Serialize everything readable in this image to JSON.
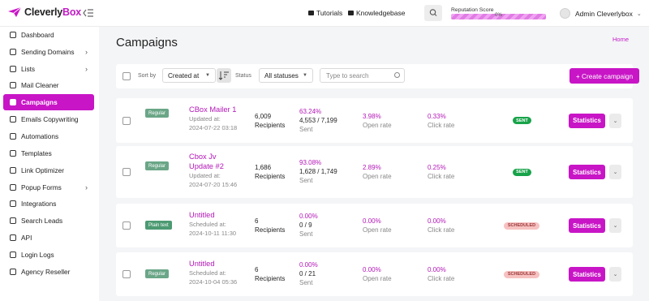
{
  "brand": {
    "name_part1": "Cleverly",
    "name_part2": "Box",
    "accent": "#c815c6"
  },
  "topbar": {
    "tutorials": "Tutorials",
    "knowledgebase": "Knowledgebase",
    "reputation_label": "Reputation Score",
    "reputation_value": "0%",
    "user_name": "Admin Cleverlybox"
  },
  "sidebar": {
    "items": [
      {
        "label": "Dashboard",
        "icon": "dashboard-icon"
      },
      {
        "label": "Sending Domains",
        "icon": "globe-icon",
        "has_sub": true
      },
      {
        "label": "Lists",
        "icon": "list-icon",
        "has_sub": true
      },
      {
        "label": "Mail Cleaner",
        "icon": "mail-icon"
      },
      {
        "label": "Campaigns",
        "icon": "send-icon",
        "active": true
      },
      {
        "label": "Emails Copywriting",
        "icon": "pen-icon"
      },
      {
        "label": "Automations",
        "icon": "gear-icon"
      },
      {
        "label": "Templates",
        "icon": "template-icon"
      },
      {
        "label": "Link Optimizer",
        "icon": "link-icon"
      },
      {
        "label": "Popup Forms",
        "icon": "popup-icon",
        "has_sub": true
      },
      {
        "label": "Integrations",
        "icon": "plug-icon"
      },
      {
        "label": "Search Leads",
        "icon": "search-icon"
      },
      {
        "label": "API",
        "icon": "api-icon"
      },
      {
        "label": "Login Logs",
        "icon": "log-icon"
      },
      {
        "label": "Agency Reseller",
        "icon": "agency-icon"
      }
    ]
  },
  "page": {
    "title": "Campaigns",
    "breadcrumb": "Home"
  },
  "filters": {
    "sort_label": "Sort by",
    "sort_value": "Created at",
    "status_label": "Status",
    "status_value": "All statuses",
    "search_placeholder": "Type to search",
    "create_label": "+ Create campaign"
  },
  "campaigns": [
    {
      "type": "Regular",
      "name_line1": "CBox Mailer 1",
      "name_line2": "",
      "date_label": "Updated at:",
      "date": "2024-07-22 03:18",
      "recipients": "6,009",
      "recipients_label": "Recipients",
      "sent_pct": "63.24%",
      "sent_count": "4,553 / 7,199",
      "sent_label": "Sent",
      "open_rate": "3.98%",
      "open_label": "Open rate",
      "click_rate": "0.33%",
      "click_label": "Click rate",
      "status": "SENT",
      "stats_label": "Statistics"
    },
    {
      "type": "Regular",
      "name_line1": "Cbox Jv",
      "name_line2": "Update #2",
      "date_label": "Updated at:",
      "date": "2024-07-20 15:46",
      "recipients": "1,686",
      "recipients_label": "Recipients",
      "sent_pct": "93.08%",
      "sent_count": "1,628 / 1,749",
      "sent_label": "Sent",
      "open_rate": "2.89%",
      "open_label": "Open rate",
      "click_rate": "0.25%",
      "click_label": "Click rate",
      "status": "SENT",
      "stats_label": "Statistics"
    },
    {
      "type": "Plain text",
      "name_line1": "Untitled",
      "name_line2": "",
      "date_label": "Scheduled at:",
      "date": "2024-10-11 11:30",
      "recipients": "6",
      "recipients_label": "Recipients",
      "sent_pct": "0.00%",
      "sent_count": "0 / 9",
      "sent_label": "Sent",
      "open_rate": "0.00%",
      "open_label": "Open rate",
      "click_rate": "0.00%",
      "click_label": "Click rate",
      "status": "SCHEDULED",
      "stats_label": "Statistics"
    },
    {
      "type": "Regular",
      "name_line1": "Untitled",
      "name_line2": "",
      "date_label": "Scheduled at:",
      "date": "2024-10-04 05:36",
      "recipients": "6",
      "recipients_label": "Recipients",
      "sent_pct": "0.00%",
      "sent_count": "0 / 21",
      "sent_label": "Sent",
      "open_rate": "0.00%",
      "open_label": "Open rate",
      "click_rate": "0.00%",
      "click_label": "Click rate",
      "status": "SCHEDULED",
      "stats_label": "Statistics"
    }
  ]
}
